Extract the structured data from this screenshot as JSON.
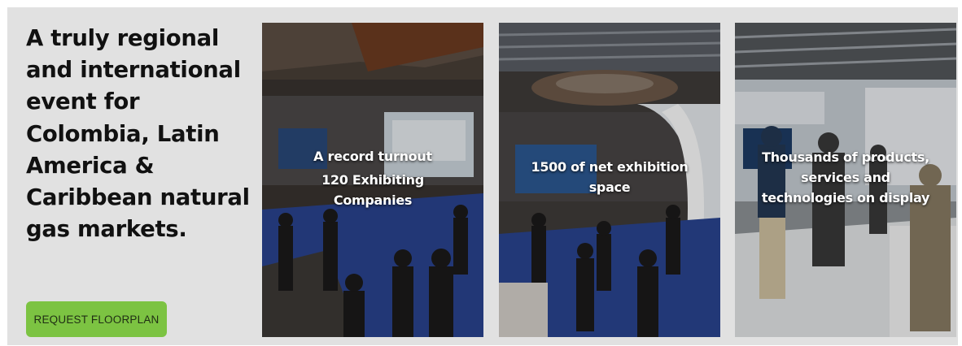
{
  "headline": "A truly regional and international event for Colombia, Latin America & Caribbean natural gas markets.",
  "cta": {
    "label": "REQUEST FLOORPLAN"
  },
  "cards": [
    {
      "line1": "A record turnout",
      "line2": "120 Exhibiting",
      "line3": "Companies"
    },
    {
      "line1": "1500 of net exhibition",
      "line2": "space"
    },
    {
      "line1": "Thousands of products,",
      "line2": "services and",
      "line3": "technologies on display"
    }
  ],
  "colors": {
    "panel_bg": "#e1e1e1",
    "cta_bg": "#7cc342",
    "headline": "#111111",
    "caption": "#ffffff"
  }
}
